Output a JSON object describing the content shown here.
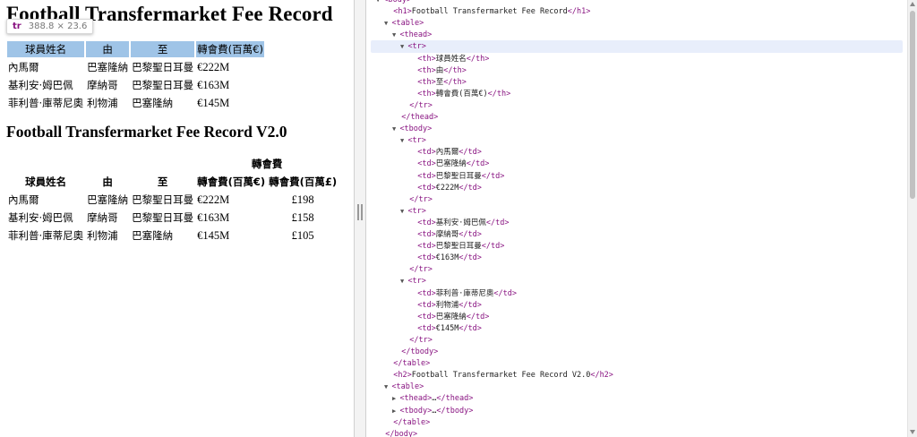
{
  "page": {
    "title": "Football Transfermarket Fee Record",
    "tooltip": {
      "tag": "tr",
      "size": "388.8 × 23.6"
    },
    "table1": {
      "headers": [
        "球員姓名",
        "由",
        "至",
        "轉會費(百萬€)"
      ],
      "rows": [
        [
          "內馬爾",
          "巴塞隆納",
          "巴黎聖日耳曼",
          "€222M"
        ],
        [
          "基利安·姆巴佩",
          "摩納哥",
          "巴黎聖日耳曼",
          "€163M"
        ],
        [
          "菲利普·庫蒂尼奧",
          "利物浦",
          "巴塞隆納",
          "€145M"
        ]
      ]
    },
    "subtitle": "Football Transfermarket Fee Record V2.0",
    "table2": {
      "headers": [
        "球員姓名",
        "由",
        "至"
      ],
      "group_header": "轉會費",
      "sub_headers": [
        "轉會費(百萬€)",
        "轉會費(百萬£)"
      ],
      "rows": [
        [
          "內馬爾",
          "巴塞隆納",
          "巴黎聖日耳曼",
          "€222M",
          "£198"
        ],
        [
          "基利安·姆巴佩",
          "摩納哥",
          "巴黎聖日耳曼",
          "€163M",
          "£158"
        ],
        [
          "菲利普·庫蒂尼奧",
          "利物浦",
          "巴塞隆納",
          "€145M",
          "£105"
        ]
      ]
    }
  },
  "devtools": {
    "lines": [
      {
        "tri": "▼",
        "tag": "<body>",
        "text": ""
      },
      {
        "tri": "",
        "tag": "<h1>",
        "text": "Football Transfermarket Fee Record",
        "close": "</h1>"
      },
      {
        "tri": "▼",
        "tag": "<table>",
        "text": ""
      },
      {
        "tri": "▼",
        "tag": "<thead>",
        "text": ""
      },
      {
        "tri": "▼",
        "tag": "<tr>",
        "text": ""
      },
      {
        "tri": "",
        "tag": "<th>",
        "text": "球員姓名",
        "close": "</th>"
      },
      {
        "tri": "",
        "tag": "<th>",
        "text": "由",
        "close": "</th>"
      },
      {
        "tri": "",
        "tag": "<th>",
        "text": "至",
        "close": "</th>"
      },
      {
        "tri": "",
        "tag": "<th>",
        "text": "轉會費(百萬€)",
        "close": "</th>"
      },
      {
        "tri": "",
        "tag": "</tr>",
        "text": ""
      },
      {
        "tri": "",
        "tag": "</thead>",
        "text": ""
      },
      {
        "tri": "▼",
        "tag": "<tbody>",
        "text": ""
      },
      {
        "tri": "▼",
        "tag": "<tr>",
        "text": ""
      },
      {
        "tri": "",
        "tag": "<td>",
        "text": "內馬爾",
        "close": "</td>"
      },
      {
        "tri": "",
        "tag": "<td>",
        "text": "巴塞隆納",
        "close": "</td>"
      },
      {
        "tri": "",
        "tag": "<td>",
        "text": "巴黎聖日耳曼",
        "close": "</td>"
      },
      {
        "tri": "",
        "tag": "<td>",
        "text": "€222M",
        "close": "</td>"
      },
      {
        "tri": "",
        "tag": "</tr>",
        "text": ""
      },
      {
        "tri": "▼",
        "tag": "<tr>",
        "text": ""
      },
      {
        "tri": "",
        "tag": "<td>",
        "text": "基利安·姆巴佩",
        "close": "</td>"
      },
      {
        "tri": "",
        "tag": "<td>",
        "text": "摩納哥",
        "close": "</td>"
      },
      {
        "tri": "",
        "tag": "<td>",
        "text": "巴黎聖日耳曼",
        "close": "</td>"
      },
      {
        "tri": "",
        "tag": "<td>",
        "text": "€163M",
        "close": "</td>"
      },
      {
        "tri": "",
        "tag": "</tr>",
        "text": ""
      },
      {
        "tri": "▼",
        "tag": "<tr>",
        "text": ""
      },
      {
        "tri": "",
        "tag": "<td>",
        "text": "菲利普·庫蒂尼奧",
        "close": "</td>"
      },
      {
        "tri": "",
        "tag": "<td>",
        "text": "利物浦",
        "close": "</td>"
      },
      {
        "tri": "",
        "tag": "<td>",
        "text": "巴塞隆納",
        "close": "</td>"
      },
      {
        "tri": "",
        "tag": "<td>",
        "text": "€145M",
        "close": "</td>"
      },
      {
        "tri": "",
        "tag": "</tr>",
        "text": ""
      },
      {
        "tri": "",
        "tag": "</tbody>",
        "text": ""
      },
      {
        "tri": "",
        "tag": "</table>",
        "text": ""
      },
      {
        "tri": "",
        "tag": "<h2>",
        "text": "Football Transfermarket Fee Record V2.0",
        "close": "</h2>"
      },
      {
        "tri": "▼",
        "tag": "<table>",
        "text": ""
      },
      {
        "tri": "▶",
        "tag": "<thead>",
        "text": "…",
        "close": "</thead>"
      },
      {
        "tri": "▶",
        "tag": "<tbody>",
        "text": "…",
        "close": "</tbody>"
      },
      {
        "tri": "",
        "tag": "</table>",
        "text": ""
      },
      {
        "tri": "",
        "tag": "</body>",
        "text": ""
      }
    ]
  }
}
